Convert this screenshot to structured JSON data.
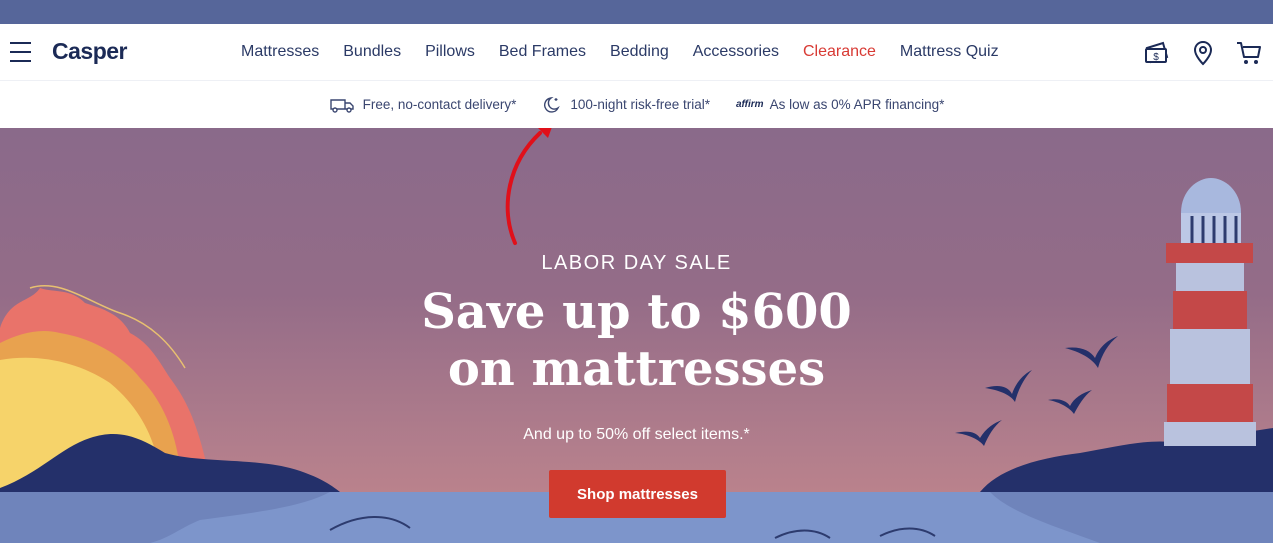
{
  "brand": {
    "name": "Casper"
  },
  "nav": {
    "items": [
      "Mattresses",
      "Bundles",
      "Pillows",
      "Bed Frames",
      "Bedding",
      "Accessories",
      "Clearance",
      "Mattress Quiz"
    ],
    "icons": [
      "financing-icon",
      "location-pin-icon",
      "cart-icon"
    ]
  },
  "perks": {
    "delivery": "Free, no-contact delivery*",
    "trial": "100-night risk-free trial*",
    "affirm_logo": "affirm",
    "financing": "As low as 0% APR financing*"
  },
  "hero": {
    "eyebrow": "LABOR DAY SALE",
    "headline_line1": "Save up to $600",
    "headline_line2": "on mattresses",
    "subtext": "And up to 50% off select items.*",
    "cta": "Shop mattresses"
  },
  "colors": {
    "topbar": "#56669a",
    "brand_navy": "#1b2a56",
    "clearance_red": "#d83a34",
    "cta_red": "#d13a2e",
    "annotation_red": "#e0101a"
  }
}
